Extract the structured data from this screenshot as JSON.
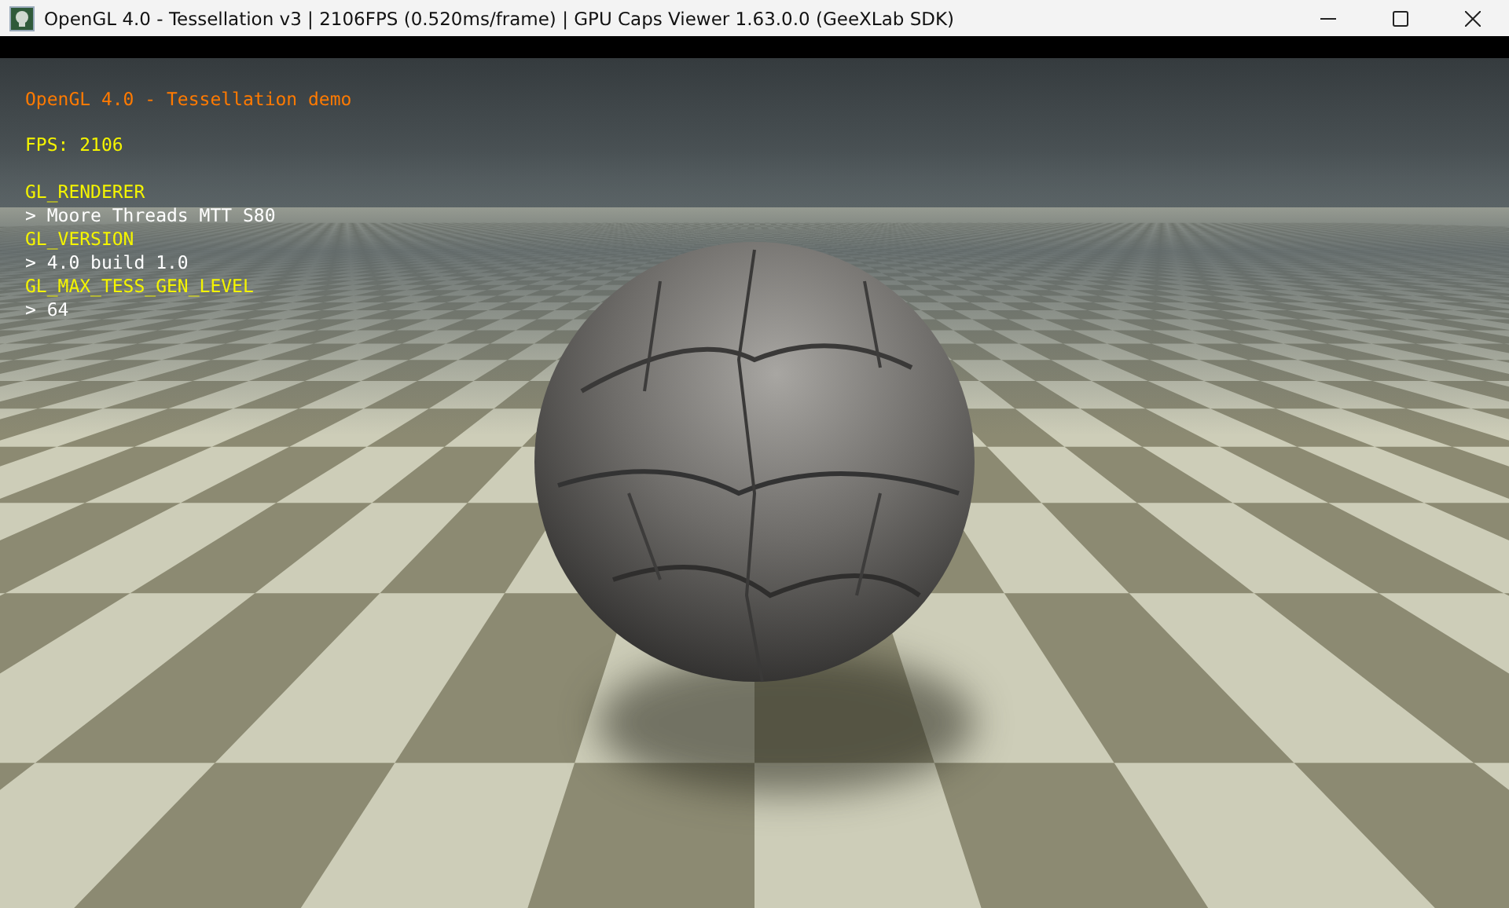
{
  "window": {
    "title": "OpenGL 4.0 - Tessellation v3 | 2106FPS (0.520ms/frame) | GPU Caps Viewer 1.63.0.0 (GeeXLab SDK)"
  },
  "overlay": {
    "heading": "OpenGL 4.0 - Tessellation demo",
    "fps": "FPS: 2106",
    "info": [
      {
        "label": "GL_RENDERER",
        "value": "> Moore Threads MTT S80"
      },
      {
        "label": "GL_VERSION",
        "value": "> 4.0 build 1.0"
      },
      {
        "label": "GL_MAX_TESS_GEN_LEVEL",
        "value": "> 64"
      }
    ]
  }
}
